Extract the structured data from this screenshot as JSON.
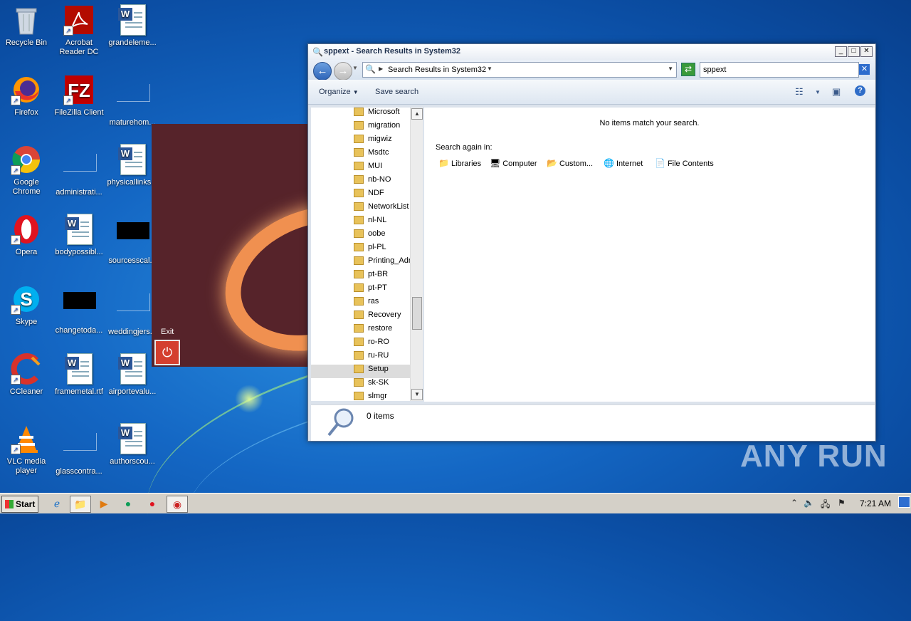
{
  "desktop": {
    "icons": [
      {
        "label": "Recycle Bin"
      },
      {
        "label": "Acrobat Reader DC"
      },
      {
        "label": "grandeleme..."
      },
      {
        "label": "Firefox"
      },
      {
        "label": "FileZilla Client"
      },
      {
        "label": "maturehom..."
      },
      {
        "label": "Google Chrome"
      },
      {
        "label": "administrati..."
      },
      {
        "label": "physicallinks..."
      },
      {
        "label": "Opera"
      },
      {
        "label": "bodypossibl..."
      },
      {
        "label": "sourcesscal..."
      },
      {
        "label": "Skype"
      },
      {
        "label": "changetoda..."
      },
      {
        "label": "weddingjers..."
      },
      {
        "label": "CCleaner"
      },
      {
        "label": "framemetal.rtf"
      },
      {
        "label": "airportevalu..."
      },
      {
        "label": "VLC media player"
      },
      {
        "label": "glasscontra..."
      },
      {
        "label": "authorscou..."
      }
    ]
  },
  "popup": {
    "exit_label": "Exit",
    "exit_icon": "power-icon"
  },
  "explorer": {
    "title": "sppext - Search Results in System32",
    "address": "Search Results in System32",
    "search_value": "sppext",
    "toolbar": {
      "organize": "Organize",
      "save_search": "Save search"
    },
    "folders": [
      "Microsoft",
      "migration",
      "migwiz",
      "Msdtc",
      "MUI",
      "nb-NO",
      "NDF",
      "NetworkList",
      "nl-NL",
      "oobe",
      "pl-PL",
      "Printing_Adm",
      "pt-BR",
      "pt-PT",
      "ras",
      "Recovery",
      "restore",
      "ro-RO",
      "ru-RU",
      "Setup",
      "sk-SK",
      "slmgr"
    ],
    "selected_folder": "Setup",
    "no_items": "No items match your search.",
    "search_again": "Search again in:",
    "locations": [
      "Libraries",
      "Computer",
      "Custom...",
      "Internet",
      "File Contents"
    ],
    "details_count": "0 items"
  },
  "taskbar": {
    "start": "Start",
    "clock": "7:21 AM"
  },
  "watermark": "ANY RUN",
  "colors": {
    "desktop": "#1467c4",
    "accent": "#2c64b8",
    "popup": "#56232a",
    "exit_button": "#d43f2f"
  }
}
